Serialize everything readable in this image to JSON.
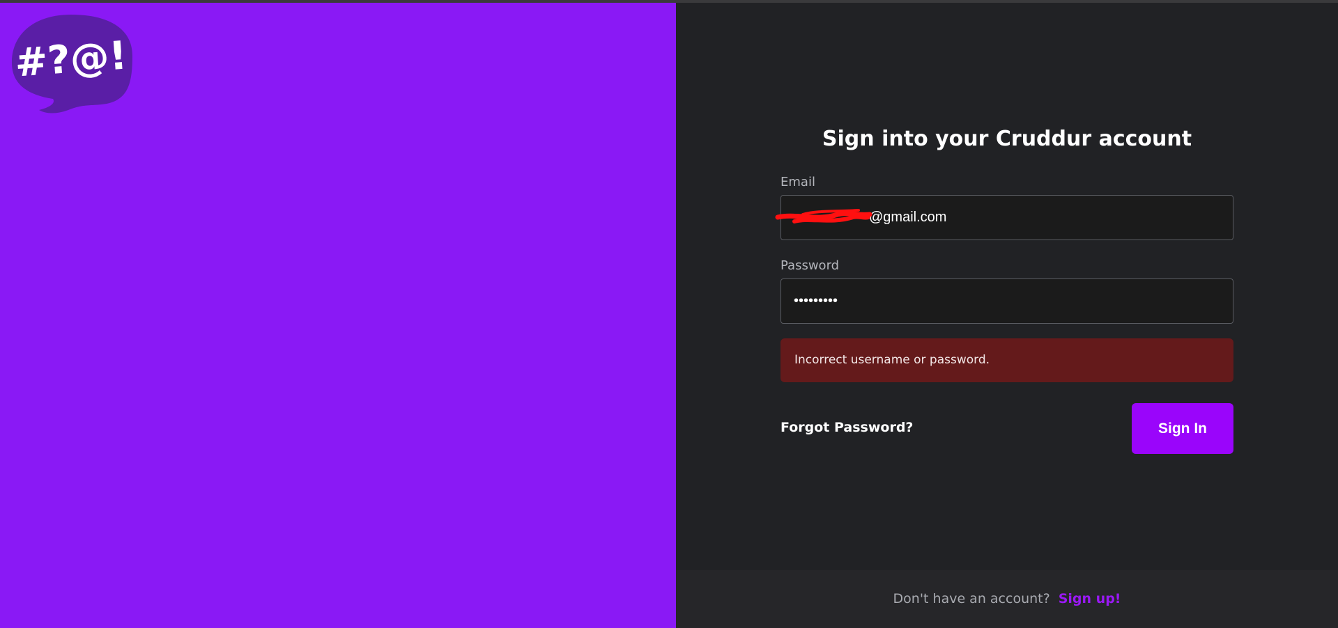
{
  "brand": {
    "logo_text": "#?@!",
    "colors": {
      "left_panel": "#8a19f5",
      "logo_bubble": "#5a1ea6",
      "right_panel": "#212225",
      "accent": "#9a05fb",
      "error_bg": "#641a1b"
    }
  },
  "signin": {
    "title": "Sign into your Cruddur account",
    "email": {
      "label": "Email",
      "value": "@gmail.com"
    },
    "password": {
      "label": "Password",
      "value": "123456789"
    },
    "error_message": "Incorrect username or password.",
    "forgot_label": "Forgot Password?",
    "submit_label": "Sign In"
  },
  "footer": {
    "prompt": "Don't have an account?",
    "signup_label": "Sign up!"
  }
}
